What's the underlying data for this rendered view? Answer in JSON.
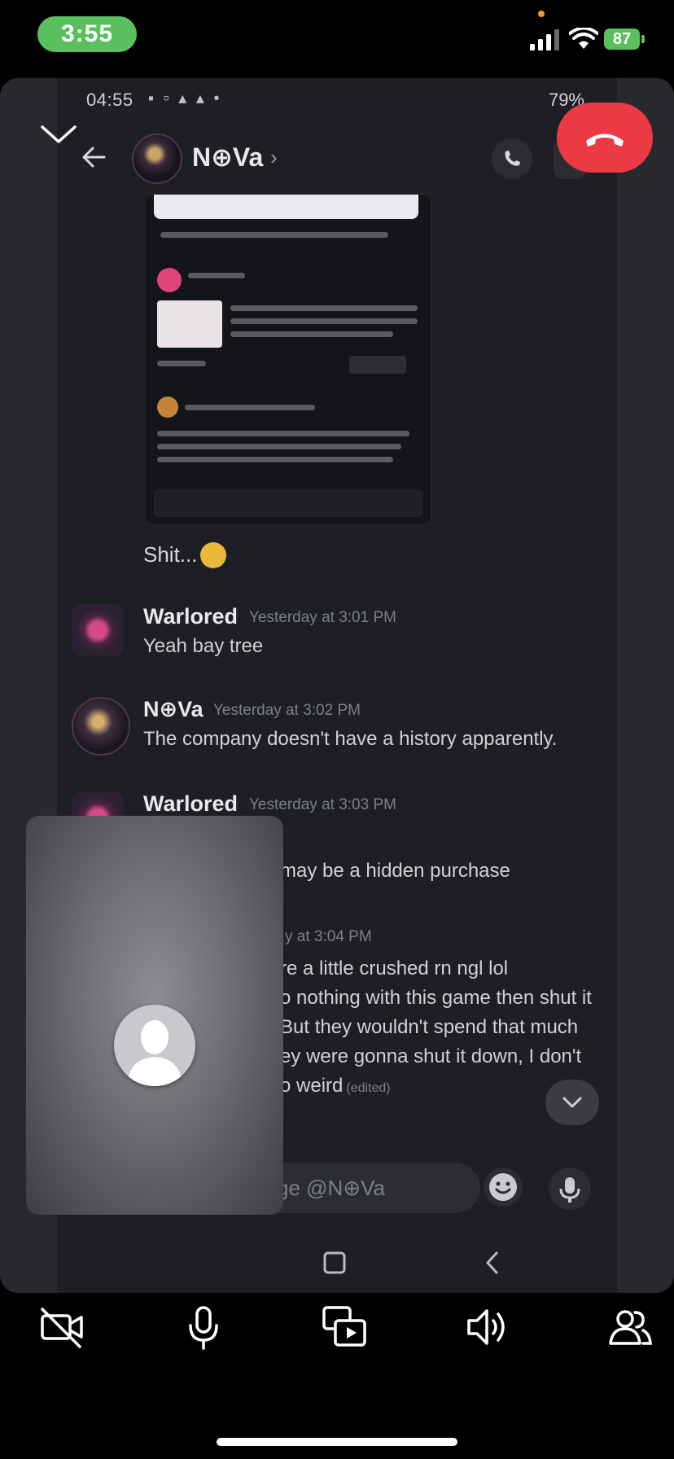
{
  "ios_status": {
    "time": "3:55",
    "battery": "87"
  },
  "shared_screen": {
    "status": {
      "time": "04:55",
      "battery": "79%"
    },
    "header": {
      "contact_name": "N⊕Va"
    },
    "caption": "Shit...",
    "messages": [
      {
        "author": "Warlored",
        "time": "Yesterday at 3:01 PM",
        "text": "Yeah bay tree"
      },
      {
        "author": "N⊕Va",
        "time": "Yesterday at 3:02 PM",
        "text": "The company doesn't have a history apparently."
      },
      {
        "author": "Warlored",
        "time": "Yesterday at 3:03 PM"
      }
    ],
    "partial_lines": [
      "may be a hidden purchase",
      "y at 3:04 PM",
      "re a little crushed rn ngl lol",
      "o nothing with this game then shut it",
      "But they wouldn't spend that much",
      "ey were gonna shut it down, I don't",
      "o weird"
    ],
    "edited_label": "(edited)",
    "composer_placeholder": "ge @N⊕Va"
  },
  "colors": {
    "end_call": "#ec3a45",
    "status_pill": "#5ac05e"
  },
  "icons": [
    "chevron-down-icon",
    "phone-hangup-icon",
    "camera-off-icon",
    "microphone-icon",
    "screen-share-icon",
    "speaker-icon",
    "participants-icon"
  ]
}
